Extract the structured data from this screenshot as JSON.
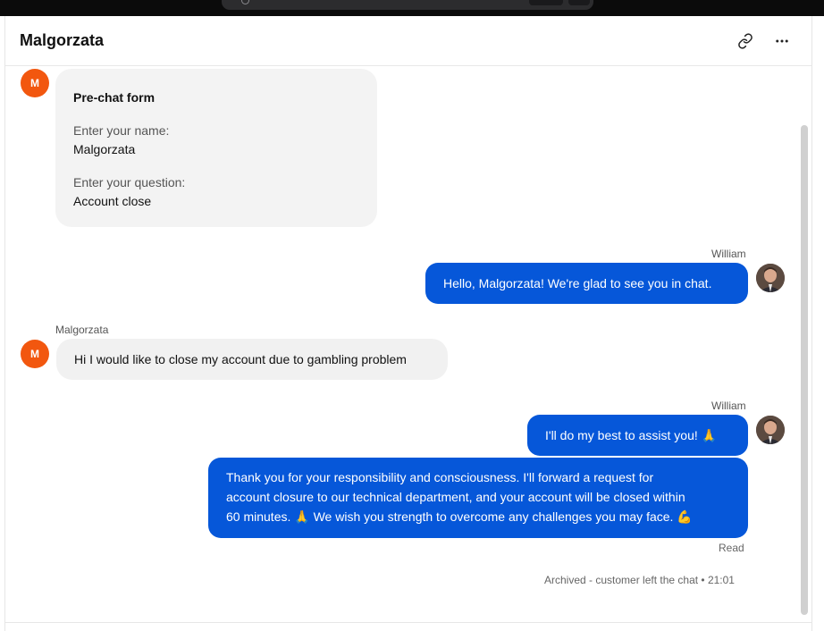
{
  "header": {
    "title": "Malgorzata"
  },
  "icons": {
    "link": "link-icon",
    "more": "more-horizontal-icon"
  },
  "colors": {
    "accent": "#0657d9",
    "customer_avatar": "#f2570f",
    "incoming_bubble": "#f1f1f1"
  },
  "customer": {
    "initial": "M",
    "name": "Malgorzata"
  },
  "prechat": {
    "title": "Pre-chat form",
    "name_label": "Enter your name:",
    "name_value": "Malgorzata",
    "question_label": "Enter your question:",
    "question_value": "Account close"
  },
  "messages": [
    {
      "sender": "William",
      "text": "Hello, Malgorzata! We're glad to see you in chat."
    },
    {
      "sender": "Malgorzata",
      "text": "Hi I would like to close my account due to gambling problem"
    },
    {
      "sender": "William",
      "text": "I'll do my best to assist you! 🙏"
    },
    {
      "sender": "William",
      "line1": "Thank you for your responsibility and consciousness. I'll forward a request for",
      "line2": "account closure to our technical department, and your account will be closed within",
      "line3": "60 minutes. 🙏 We wish you strength to overcome any challenges you may face. 💪"
    }
  ],
  "status": {
    "read": "Read",
    "archived": "Archived - customer left the chat • 21:01"
  }
}
